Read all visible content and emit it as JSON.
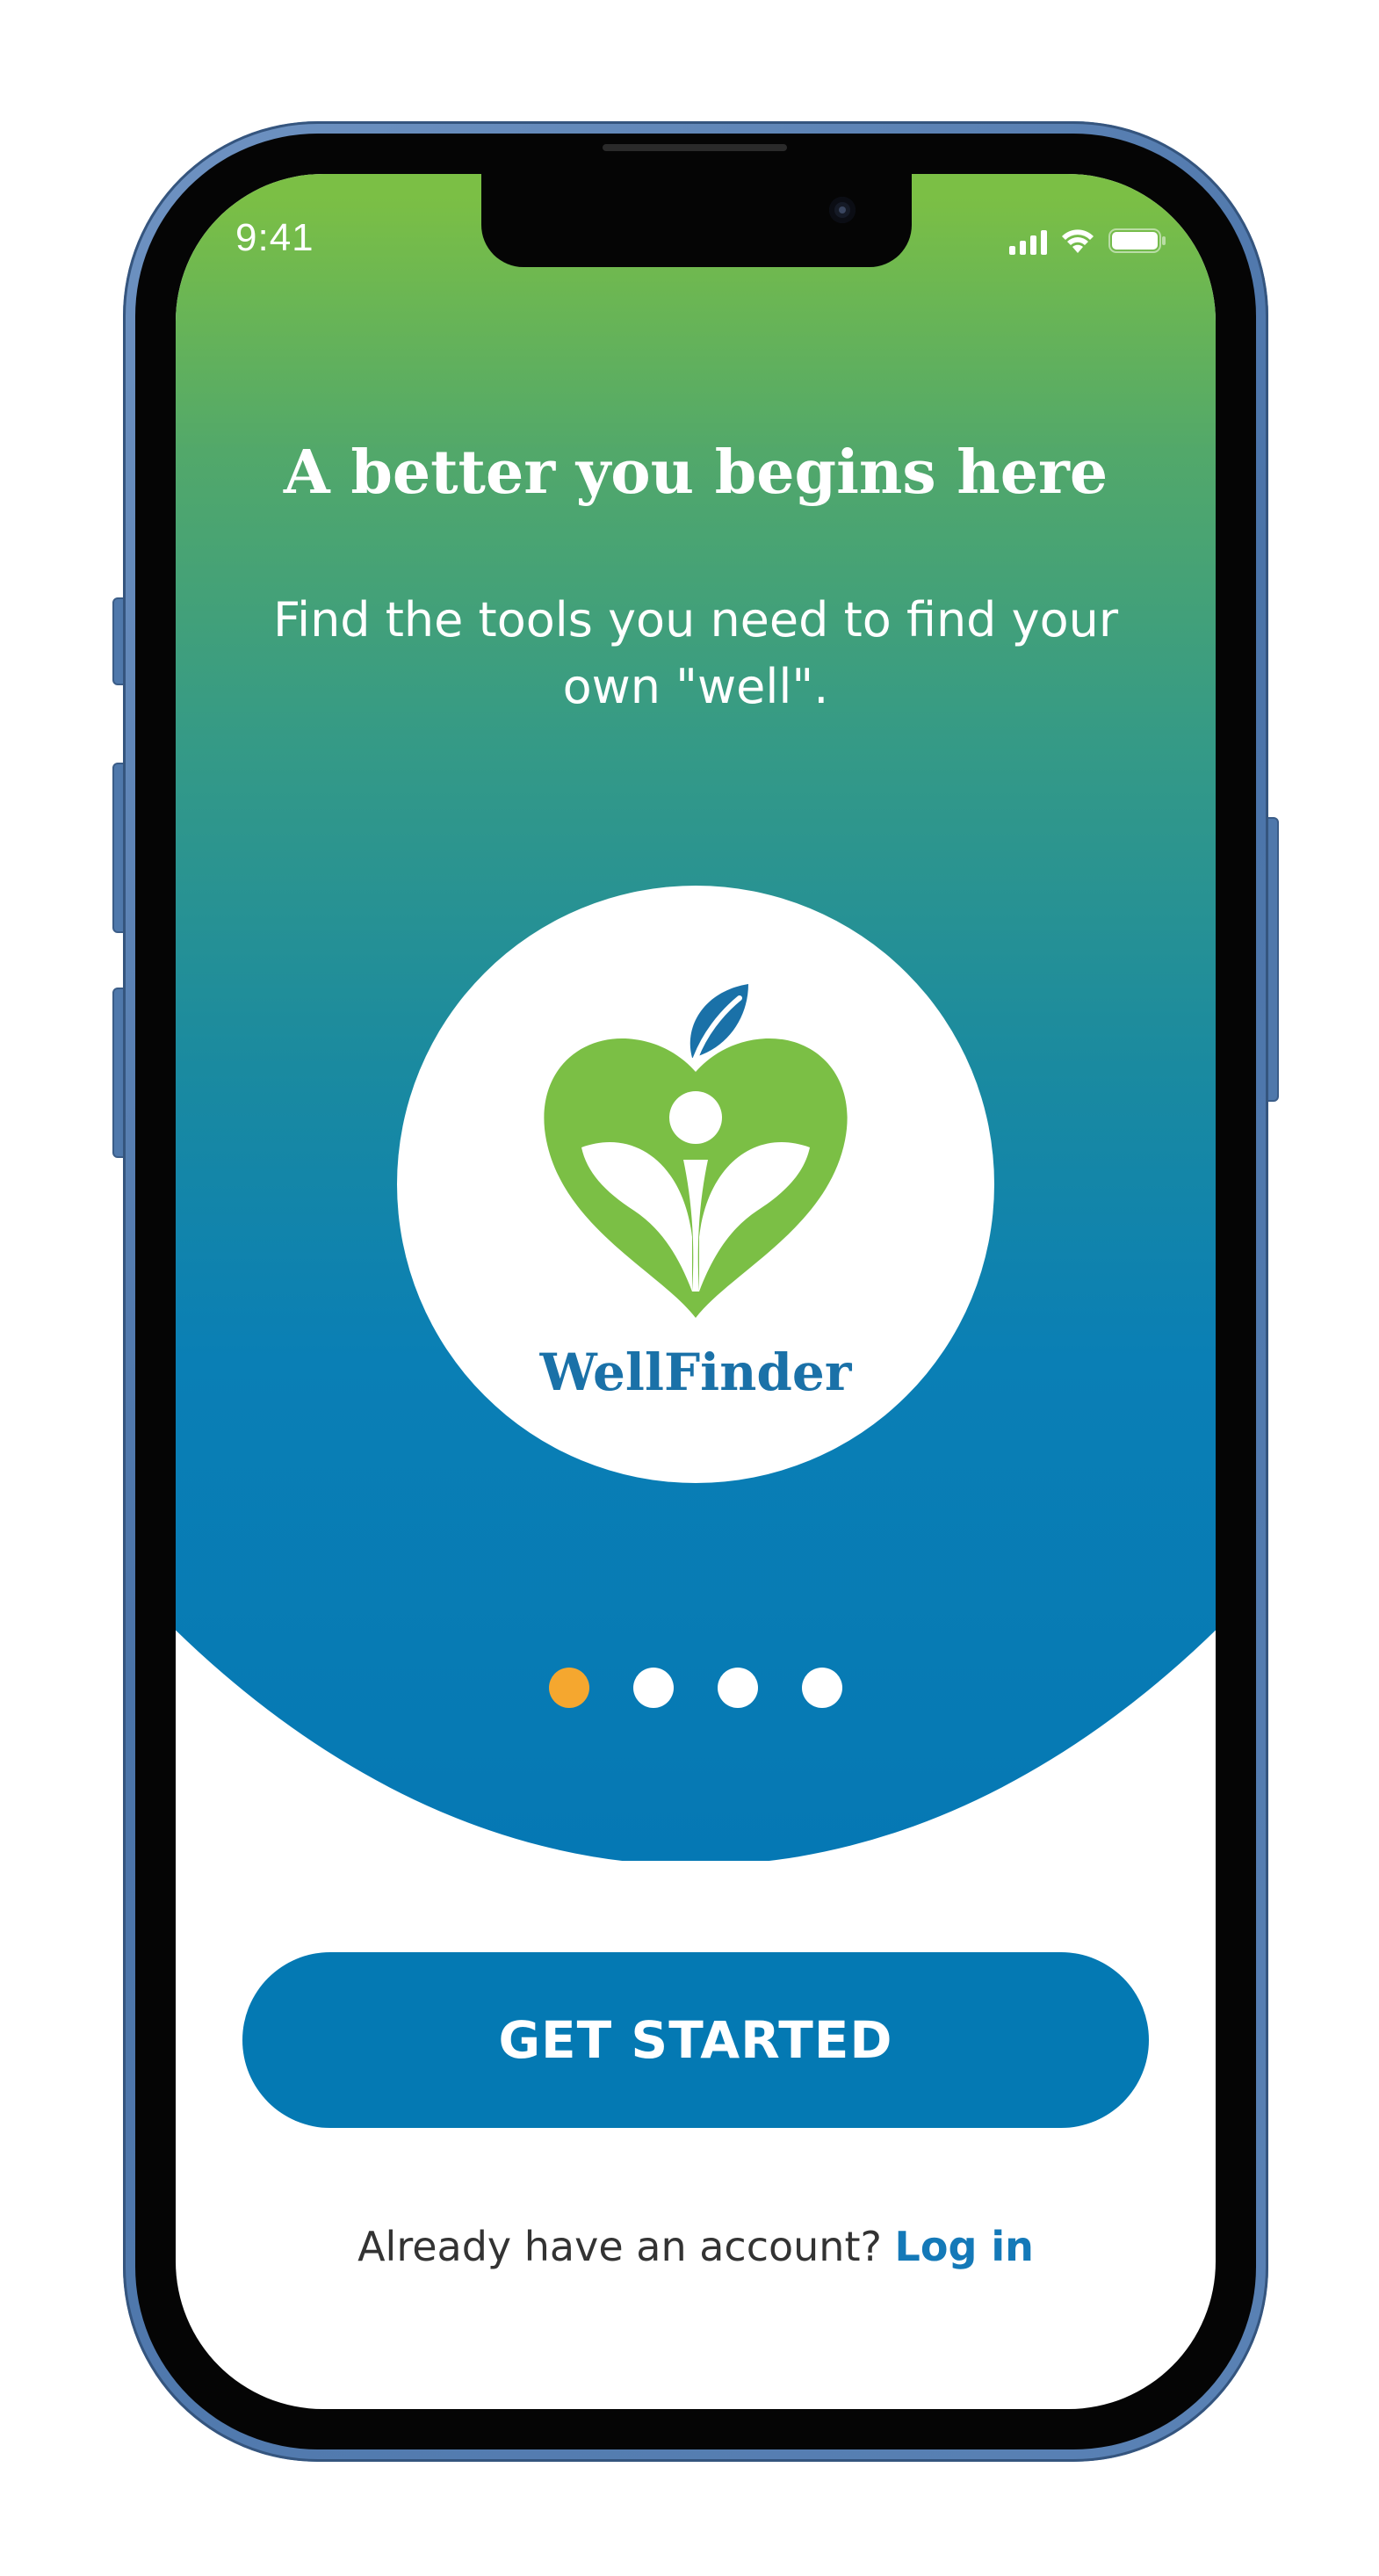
{
  "status_bar": {
    "time": "9:41",
    "signal_icon": "cellular-signal-icon",
    "wifi_icon": "wifi-icon",
    "battery_icon": "battery-icon"
  },
  "onboarding": {
    "headline": "A better you begins here",
    "subheadline": "Find the tools you need to find your own \"well\".",
    "brand_name": "WellFinder",
    "pagination": {
      "total_pages": 4,
      "current_page": 1
    },
    "primary_button_label": "GET STARTED",
    "login_prompt": "Already have an account?",
    "login_link_label": "Log in"
  },
  "colors": {
    "gradient_top": "#7bbf45",
    "gradient_bottom": "#0578b4",
    "accent_orange": "#f5a72f",
    "brand_blue": "#0479b3",
    "link_blue": "#1479b8",
    "logo_green": "#7bbf45"
  }
}
